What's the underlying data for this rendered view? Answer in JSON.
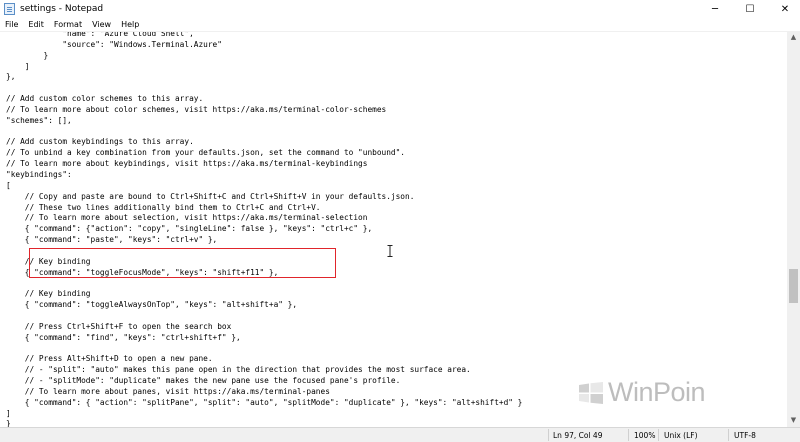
{
  "window": {
    "title": "settings - Notepad",
    "minimize_glyph": "─",
    "maximize_glyph": "☐",
    "close_glyph": "✕"
  },
  "menu": [
    "File",
    "Edit",
    "Format",
    "View",
    "Help"
  ],
  "editor": {
    "lines": [
      "            \"name\": \"Azure Cloud Shell\",",
      "            \"source\": \"Windows.Terminal.Azure\"",
      "        }",
      "    ]",
      "},",
      "",
      "// Add custom color schemes to this array.",
      "// To learn more about color schemes, visit https://aka.ms/terminal-color-schemes",
      "\"schemes\": [],",
      "",
      "// Add custom keybindings to this array.",
      "// To unbind a key combination from your defaults.json, set the command to \"unbound\".",
      "// To learn more about keybindings, visit https://aka.ms/terminal-keybindings",
      "\"keybindings\":",
      "[",
      "    // Copy and paste are bound to Ctrl+Shift+C and Ctrl+Shift+V in your defaults.json.",
      "    // These two lines additionally bind them to Ctrl+C and Ctrl+V.",
      "    // To learn more about selection, visit https://aka.ms/terminal-selection",
      "    { \"command\": {\"action\": \"copy\", \"singleLine\": false }, \"keys\": \"ctrl+c\" },",
      "    { \"command\": \"paste\", \"keys\": \"ctrl+v\" },",
      "",
      "    // Key binding",
      "    { \"command\": \"toggleFocusMode\", \"keys\": \"shift+f11\" },",
      "",
      "    // Key binding",
      "    { \"command\": \"toggleAlwaysOnTop\", \"keys\": \"alt+shift+a\" },",
      "",
      "    // Press Ctrl+Shift+F to open the search box",
      "    { \"command\": \"find\", \"keys\": \"ctrl+shift+f\" },",
      "",
      "    // Press Alt+Shift+D to open a new pane.",
      "    // - \"split\": \"auto\" makes this pane open in the direction that provides the most surface area.",
      "    // - \"splitMode\": \"duplicate\" makes the new pane use the focused pane's profile.",
      "    // To learn more about panes, visit https://aka.ms/terminal-panes",
      "    { \"command\": { \"action\": \"splitPane\", \"split\": \"auto\", \"splitMode\": \"duplicate\" }, \"keys\": \"alt+shift+d\" }",
      "]",
      "}"
    ]
  },
  "status": {
    "position": "Ln 97, Col 49",
    "zoom": "100%",
    "line_ending": "Unix (LF)",
    "encoding": "UTF-8"
  },
  "watermark": {
    "text": "WinPoin",
    "color": "#bdbdbd"
  },
  "accent": {
    "highlight_border": "#e0252b"
  }
}
